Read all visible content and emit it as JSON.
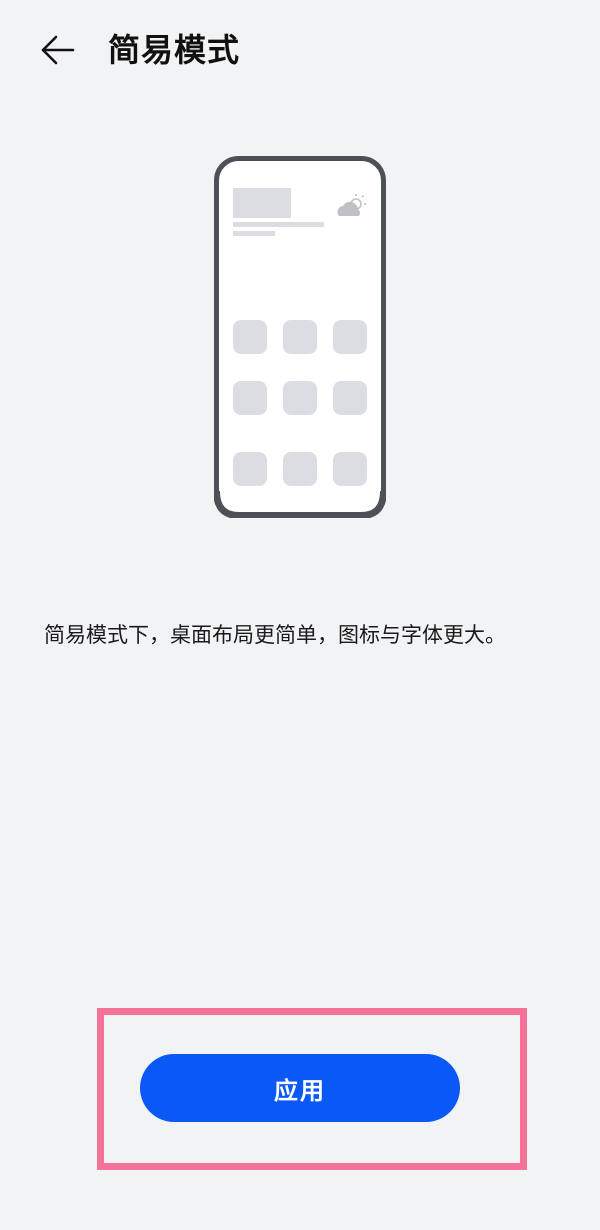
{
  "header": {
    "back_icon": "arrow-left-icon",
    "title": "简易模式"
  },
  "illustration": {
    "icon": "phone-simple-mode-illustration",
    "weather_icon": "cloud-sun-icon"
  },
  "description": "简易模式下，桌面布局更简单，图标与字体更大。",
  "apply_button": {
    "label": "应用"
  },
  "colors": {
    "background": "#f2f3f5",
    "accent": "#0a59f7",
    "highlight": "#f47398",
    "phone_frame": "#4d5057",
    "placeholder": "#dcdde2"
  }
}
